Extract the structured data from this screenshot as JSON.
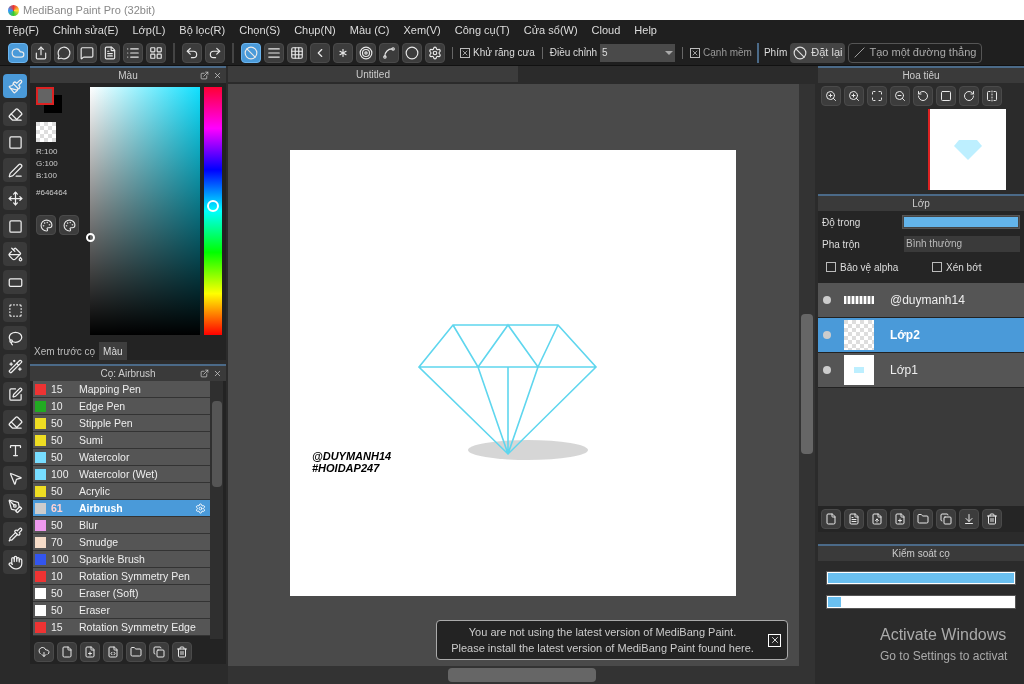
{
  "window": {
    "title": "MediBang Paint Pro (32bit)"
  },
  "menu": [
    "Tệp(F)",
    "Chỉnh sửa(E)",
    "Lớp(L)",
    "Bộ lọc(R)",
    "Chọn(S)",
    "Chụp(N)",
    "Màu (C)",
    "Xem(V)",
    "Công cụ(T)",
    "Cửa sổ(W)",
    "Cloud",
    "Help"
  ],
  "toolbar": {
    "buttons": [
      {
        "selected": true
      },
      {
        "selected": false
      },
      {
        "selected": false
      },
      {
        "selected": false
      },
      {
        "selected": false
      },
      {
        "selected": false
      },
      {
        "selected": false
      },
      {
        "selected": false
      },
      {
        "selected": false
      },
      {
        "selected": true
      },
      {
        "selected": false
      },
      {
        "selected": false
      },
      {
        "selected": false
      },
      {
        "selected": false
      },
      {
        "selected": false
      },
      {
        "selected": false
      },
      {
        "selected": false
      },
      {
        "selected": false
      }
    ],
    "antialias": {
      "label": "Khử răng cưa",
      "checked": true
    },
    "adjust": {
      "label": "Điều chỉnh",
      "value": "5"
    },
    "soft_edge": {
      "label": "Cạnh mềm",
      "checked": true
    },
    "keys_label": "Phím",
    "reset_button": "Đặt lại",
    "line_button": "Tạo một đường thẳng"
  },
  "tools": [
    {
      "selected": true
    },
    {
      "selected": false
    },
    {
      "selected": false
    },
    {
      "selected": false
    },
    {
      "selected": false
    },
    {
      "selected": false
    },
    {
      "selected": false
    },
    {
      "selected": false
    },
    {
      "selected": false
    },
    {
      "selected": false
    },
    {
      "selected": false
    },
    {
      "selected": false
    },
    {
      "selected": false
    },
    {
      "selected": false
    },
    {
      "selected": false
    },
    {
      "selected": false
    },
    {
      "selected": false
    },
    {
      "selected": false
    }
  ],
  "color_panel": {
    "title": "Màu",
    "r": "R:100",
    "g": "G:100",
    "b": "B:100",
    "hex": "#646464",
    "hue": {
      "level": 0.48
    },
    "tabs": [
      {
        "label": "Xem trước cọ",
        "selected": false
      },
      {
        "label": "Màu",
        "selected": true
      }
    ]
  },
  "brush_panel": {
    "title": "Cọ: Airbrush",
    "rows": [
      {
        "size": "15",
        "name": "Mapping Pen",
        "color": "#ee3333",
        "selected": false
      },
      {
        "size": "10",
        "name": "Edge Pen",
        "color": "#22aa22",
        "selected": false
      },
      {
        "size": "50",
        "name": "Stipple Pen",
        "color": "#eedd22",
        "selected": false
      },
      {
        "size": "50",
        "name": "Sumi",
        "color": "#eedd22",
        "selected": false
      },
      {
        "size": "50",
        "name": "Watercolor",
        "color": "#77ddff",
        "selected": false
      },
      {
        "size": "100",
        "name": "Watercolor (Wet)",
        "color": "#77ddff",
        "selected": false
      },
      {
        "size": "50",
        "name": "Acrylic",
        "color": "#eedd22",
        "selected": false
      },
      {
        "size": "61",
        "name": "Airbrush",
        "color": "#cccccc",
        "selected": true
      },
      {
        "size": "50",
        "name": "Blur",
        "color": "#ee99ee",
        "selected": false
      },
      {
        "size": "70",
        "name": "Smudge",
        "color": "#f6dcc8",
        "selected": false
      },
      {
        "size": "100",
        "name": "Sparkle Brush",
        "color": "#3355ee",
        "selected": false
      },
      {
        "size": "10",
        "name": "Rotation Symmetry Pen",
        "color": "#ee3333",
        "selected": false
      },
      {
        "size": "50",
        "name": "Eraser (Soft)",
        "color": "#ffffff",
        "selected": false
      },
      {
        "size": "50",
        "name": "Eraser",
        "color": "#ffffff",
        "selected": false
      },
      {
        "size": "15",
        "name": "Rotation Symmetry Edge",
        "color": "#ee3333",
        "selected": false
      }
    ]
  },
  "canvas": {
    "tab": "Untitled",
    "text_lines": [
      "@DUYMANH14",
      "#HOIDAP247"
    ]
  },
  "notification": {
    "lines": [
      "You are not using the latest version of MediBang Paint.",
      "Please install the latest version of MediBang Paint found here."
    ]
  },
  "navigator": {
    "title": "Hoa tiêu"
  },
  "layer_panel": {
    "title": "Lớp",
    "opacity_label": "Độ trong",
    "opacity": {
      "level": 1
    },
    "blend_label": "Pha trộn",
    "blend_value": "Bình thường",
    "protect_alpha": {
      "label": "Bảo vệ alpha",
      "checked": false
    },
    "clip": {
      "label": "Xén bớt",
      "checked": false
    },
    "layers": [
      {
        "name": "@duymanh14",
        "selected": false,
        "kind": "text"
      },
      {
        "name": "Lớp2",
        "selected": true,
        "kind": "empty"
      },
      {
        "name": "Lớp1",
        "selected": false,
        "kind": "drawing"
      }
    ]
  },
  "brush_control": {
    "title": "Kiểm soát cọ",
    "bars": [
      {
        "level": 1
      },
      {
        "level": 0.07
      }
    ]
  },
  "os_notice": {
    "title": "Activate Windows",
    "subtitle": "Go to Settings to activat"
  }
}
